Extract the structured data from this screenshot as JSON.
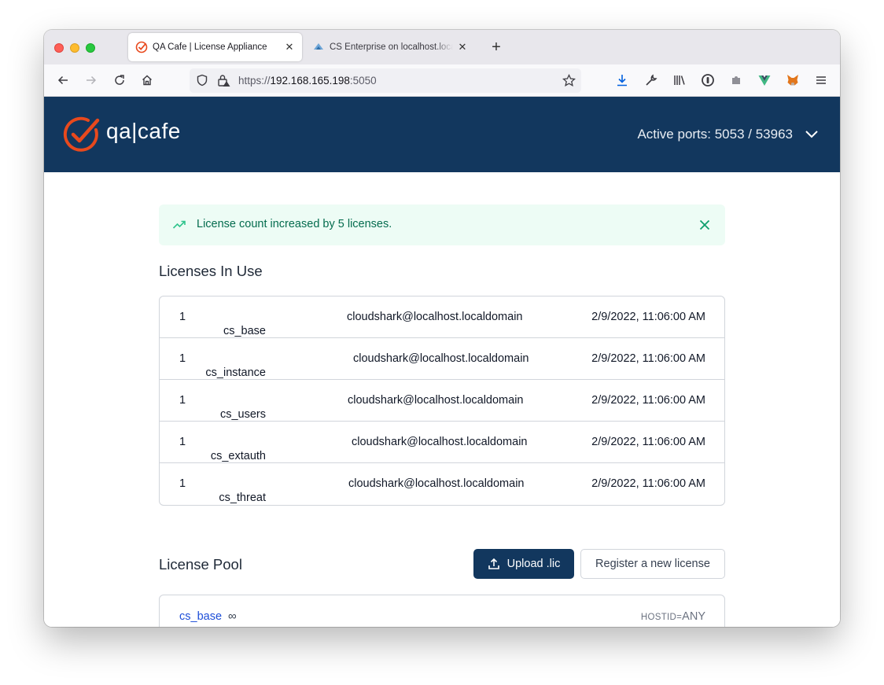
{
  "browser": {
    "tabs": [
      {
        "title": "QA Cafe | License Appliance",
        "active": true
      },
      {
        "title": "CS Enterprise on localhost.localdomain",
        "active": false
      }
    ],
    "url": {
      "scheme": "https://",
      "host": "192.168.165.198",
      "port": ":5050"
    }
  },
  "header": {
    "logo_text": "qa|cafe",
    "active_ports": "Active ports: 5053 / 53963"
  },
  "alert": {
    "message": "License count increased by 5 licenses.",
    "color": "#046c4e"
  },
  "licenses_in_use": {
    "title": "Licenses In Use",
    "rows": [
      {
        "count": "1",
        "name": "cs_base",
        "user": "cloudshark@localhost.localdomain",
        "date": "2/9/2022, 11:06:00 AM"
      },
      {
        "count": "1",
        "name": "cs_instance",
        "user": "cloudshark@localhost.localdomain",
        "date": "2/9/2022, 11:06:00 AM"
      },
      {
        "count": "1",
        "name": "cs_users",
        "user": "cloudshark@localhost.localdomain",
        "date": "2/9/2022, 11:06:00 AM"
      },
      {
        "count": "1",
        "name": "cs_extauth",
        "user": "cloudshark@localhost.localdomain",
        "date": "2/9/2022, 11:06:00 AM"
      },
      {
        "count": "1",
        "name": "cs_threat",
        "user": "cloudshark@localhost.localdomain",
        "date": "2/9/2022, 11:06:00 AM"
      }
    ]
  },
  "license_pool": {
    "title": "License Pool",
    "upload_label": "Upload .lic",
    "register_label": "Register a new license",
    "items": [
      {
        "name": "cs_base",
        "quantity": "∞",
        "hostid_label": "HOSTID=",
        "hostid_value": "ANY"
      }
    ]
  },
  "colors": {
    "brand_navy": "#12375e",
    "brand_orange": "#e8491d",
    "link": "#1d4ed8"
  }
}
